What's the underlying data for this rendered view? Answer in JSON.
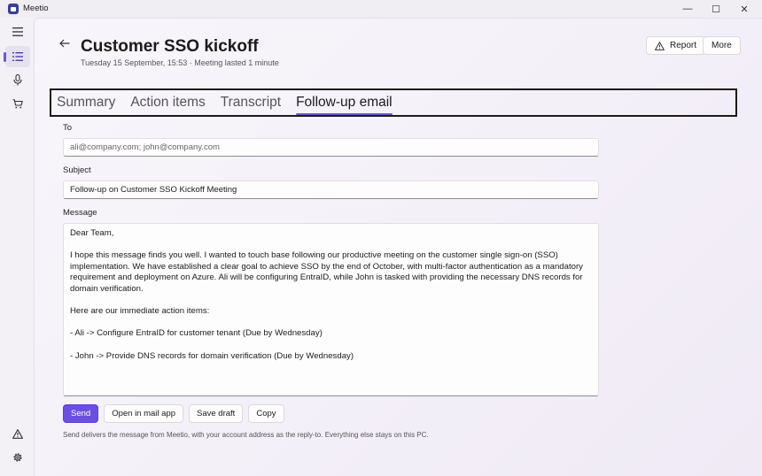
{
  "window": {
    "title": "Meetio",
    "minimize_glyph": "—",
    "maximize_glyph": "☐",
    "close_glyph": "✕"
  },
  "rail": {
    "items": [
      {
        "icon": "hamburger-icon"
      },
      {
        "icon": "list-icon",
        "active": true
      },
      {
        "icon": "microphone-icon"
      },
      {
        "icon": "cart-icon"
      }
    ],
    "bottom": [
      {
        "icon": "warning-icon"
      },
      {
        "icon": "gear-icon"
      }
    ]
  },
  "header": {
    "title": "Customer SSO kickoff",
    "subtitle": "Tuesday 15 September, 15:53 · Meeting lasted 1 minute",
    "report_label": "Report",
    "more_label": "More"
  },
  "tabs": [
    {
      "label": "Summary",
      "active": false
    },
    {
      "label": "Action items",
      "active": false
    },
    {
      "label": "Transcript",
      "active": false
    },
    {
      "label": "Follow-up email",
      "active": true
    }
  ],
  "form": {
    "to_label": "To",
    "to_value": "",
    "to_placeholder": "ali@company.com; john@company.com",
    "subject_label": "Subject",
    "subject_value": "Follow-up on Customer SSO Kickoff Meeting",
    "message_label": "Message",
    "message_paragraphs": [
      "Dear Team,",
      "I hope this message finds you well. I wanted to touch base following our productive meeting on the customer single sign-on (SSO) implementation. We have established a clear goal to achieve SSO by the end of October, with multi-factor authentication as a mandatory requirement and deployment on Azure. Ali will be configuring EntraID, while John is tasked with providing the necessary DNS records for domain verification.",
      "Here are our immediate action items:",
      "- Ali -> Configure EntraID for customer tenant (Due by Wednesday)",
      "- John -> Provide DNS records for domain verification (Due by Wednesday)"
    ]
  },
  "actions": {
    "send": "Send",
    "open_mail": "Open in mail app",
    "save_draft": "Save draft",
    "copy": "Copy"
  },
  "note": "Send delivers the message from Meetio, with your account address as the reply-to. Everything else stays on this PC.",
  "colors": {
    "accent": "#6a4fe0",
    "tab_underline": "#6a5acd"
  }
}
